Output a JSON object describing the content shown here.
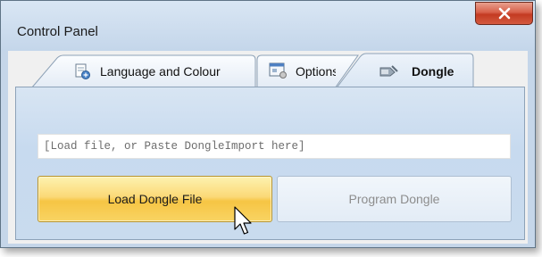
{
  "window": {
    "title": "Control Panel"
  },
  "titlebar": {
    "close_icon": "close-x-icon",
    "close_color": "#c9412a"
  },
  "tabs": [
    {
      "label": "Language and Colour",
      "icon": "language-page-icon",
      "selected": false
    },
    {
      "label": "Options",
      "icon": "options-window-icon",
      "selected": false
    },
    {
      "label": "Dongle",
      "icon": "dongle-key-icon",
      "selected": true
    }
  ],
  "dongle": {
    "import_field": {
      "value": "[Load file, or Paste DongleImport here]"
    },
    "load_button": {
      "label": "Load Dongle File",
      "state": "hover"
    },
    "program_button": {
      "label": "Program Dongle",
      "enabled": false
    }
  },
  "colors": {
    "accent_hover": "#fbd977",
    "panel": "#c9dbee"
  }
}
